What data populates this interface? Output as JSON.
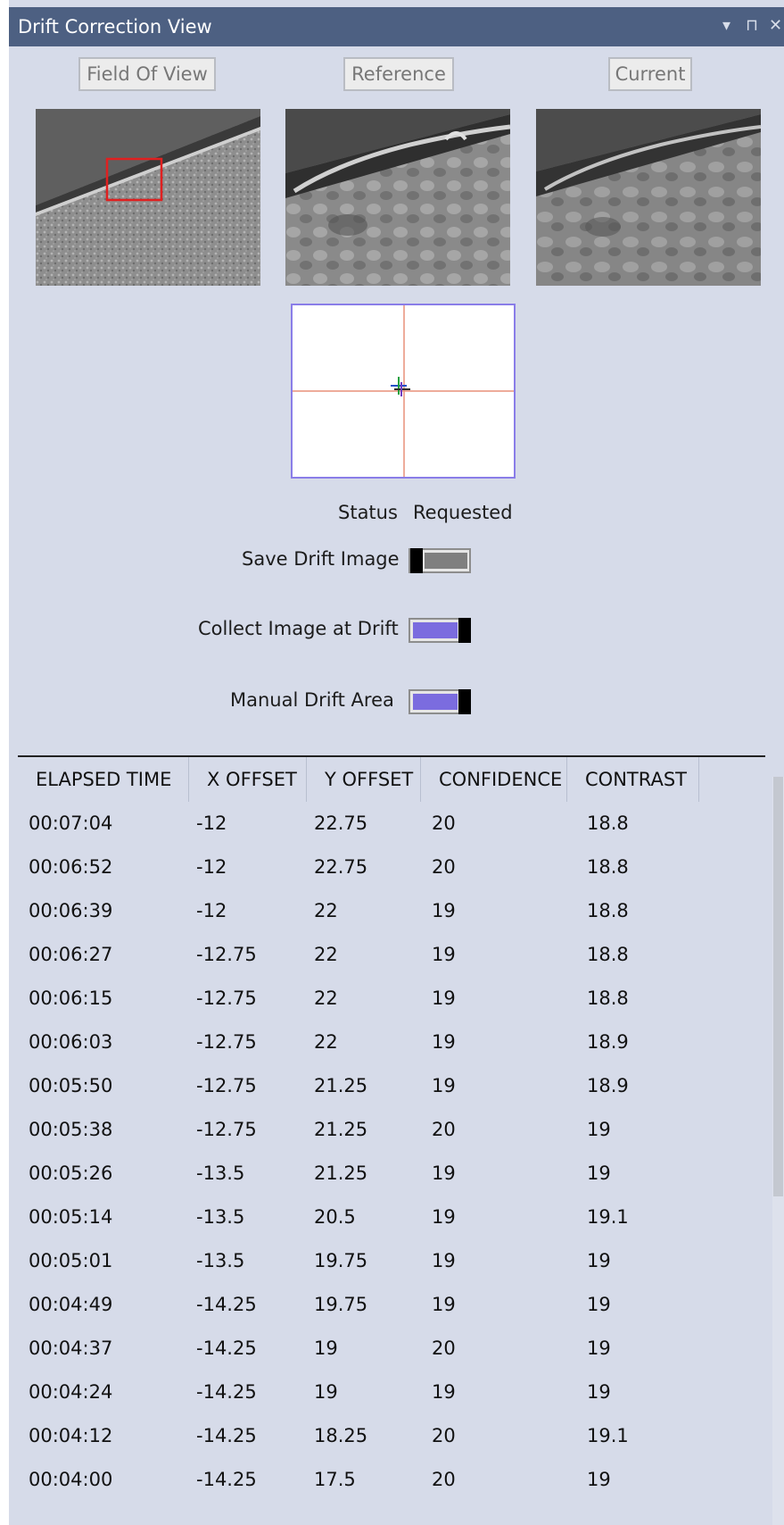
{
  "window": {
    "title": "Drift Correction View",
    "controls": {
      "dropdown": "▾",
      "pin": "⊓",
      "close": "✕"
    }
  },
  "buttons": {
    "field_of_view": "Field Of View",
    "reference": "Reference",
    "current": "Current"
  },
  "status": {
    "label": "Status",
    "value": "Requested"
  },
  "toggles": [
    {
      "label": "Save Drift Image",
      "on": false
    },
    {
      "label": "Collect Image at Drift",
      "on": true
    },
    {
      "label": "Manual Drift Area",
      "on": true
    }
  ],
  "colors": {
    "toggle_on": "#7b6cdf",
    "toggle_off": "#7f7f7f",
    "roi_box": "#e02020",
    "crosshair": "#e8907a"
  },
  "table": {
    "headers": [
      "ELAPSED TIME",
      "X OFFSET",
      "Y OFFSET",
      "CONFIDENCE",
      "CONTRAST"
    ],
    "rows": [
      [
        "00:07:04",
        "-12",
        "22.75",
        "20",
        "18.8"
      ],
      [
        "00:06:52",
        "-12",
        "22.75",
        "20",
        "18.8"
      ],
      [
        "00:06:39",
        "-12",
        "22",
        "19",
        "18.8"
      ],
      [
        "00:06:27",
        "-12.75",
        "22",
        "19",
        "18.8"
      ],
      [
        "00:06:15",
        "-12.75",
        "22",
        "19",
        "18.8"
      ],
      [
        "00:06:03",
        "-12.75",
        "22",
        "19",
        "18.9"
      ],
      [
        "00:05:50",
        "-12.75",
        "21.25",
        "19",
        "18.9"
      ],
      [
        "00:05:38",
        "-12.75",
        "21.25",
        "20",
        "19"
      ],
      [
        "00:05:26",
        "-13.5",
        "21.25",
        "19",
        "19"
      ],
      [
        "00:05:14",
        "-13.5",
        "20.5",
        "19",
        "19.1"
      ],
      [
        "00:05:01",
        "-13.5",
        "19.75",
        "19",
        "19"
      ],
      [
        "00:04:49",
        "-14.25",
        "19.75",
        "19",
        "19"
      ],
      [
        "00:04:37",
        "-14.25",
        "19",
        "20",
        "19"
      ],
      [
        "00:04:24",
        "-14.25",
        "19",
        "19",
        "19"
      ],
      [
        "00:04:12",
        "-14.25",
        "18.25",
        "20",
        "19.1"
      ],
      [
        "00:04:00",
        "-14.25",
        "17.5",
        "20",
        "19"
      ]
    ]
  }
}
